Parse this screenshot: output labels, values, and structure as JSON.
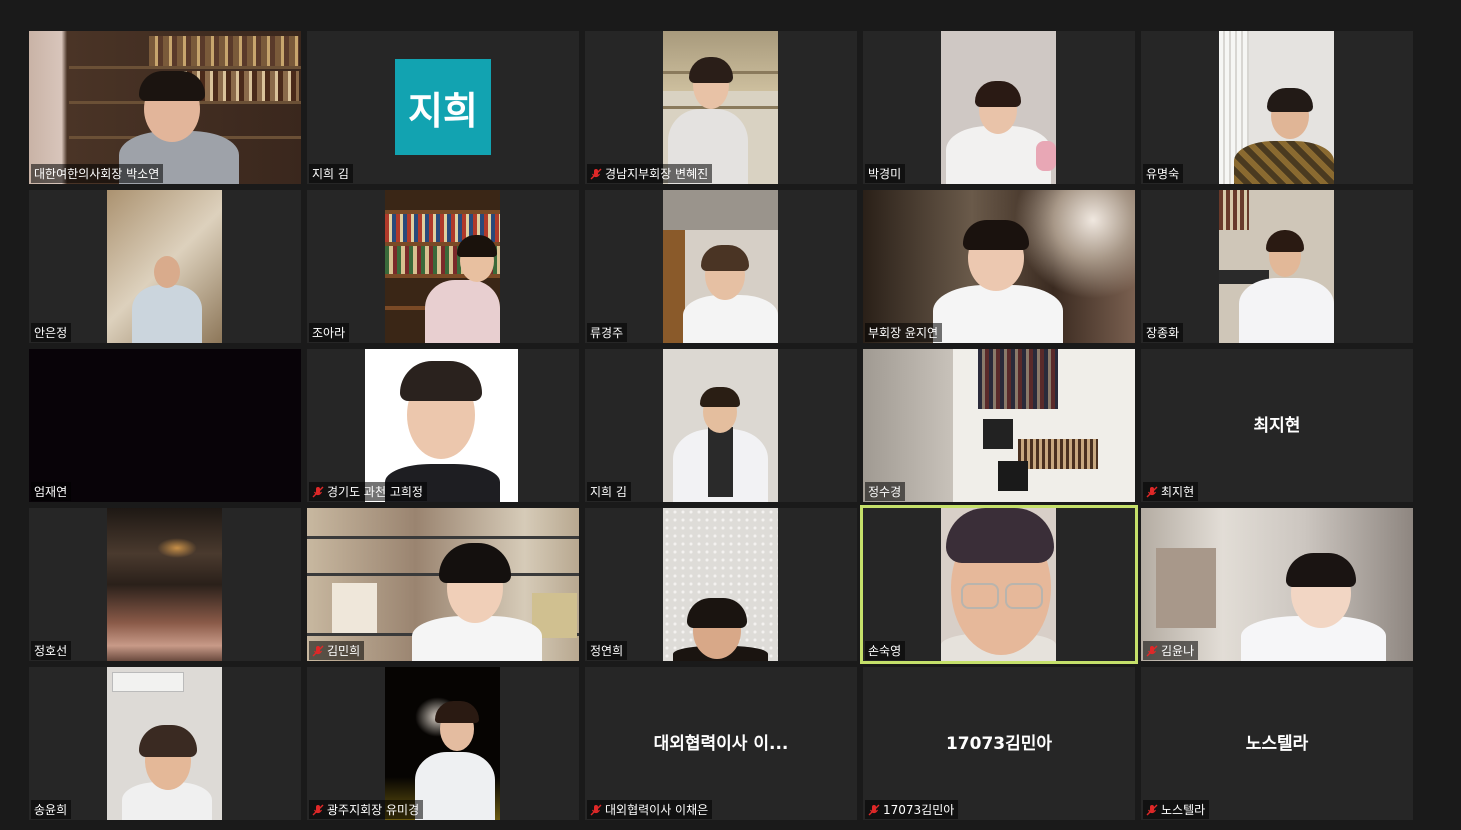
{
  "meeting": {
    "active_speaker": "손숙영",
    "accent_color": "#c5e06a",
    "avatar_color": "#12a3b1",
    "participants": [
      {
        "name": "대한여한의사회장 박소연",
        "muted": false,
        "type": "video"
      },
      {
        "name": "지희 김",
        "muted": false,
        "type": "avatar",
        "avatar_text": "지희"
      },
      {
        "name": "경남지부회장 변혜진",
        "muted": true,
        "type": "video"
      },
      {
        "name": "박경미",
        "muted": false,
        "type": "video"
      },
      {
        "name": "유명숙",
        "muted": false,
        "type": "video"
      },
      {
        "name": "안은정",
        "muted": false,
        "type": "video"
      },
      {
        "name": "조아라",
        "muted": false,
        "type": "video"
      },
      {
        "name": "류경주",
        "muted": false,
        "type": "video"
      },
      {
        "name": "부회장 윤지연",
        "muted": false,
        "type": "video"
      },
      {
        "name": "장종화",
        "muted": false,
        "type": "video"
      },
      {
        "name": "엄재연",
        "muted": false,
        "type": "video"
      },
      {
        "name": "경기도 과천 고희정",
        "muted": true,
        "type": "video"
      },
      {
        "name": "지희 김",
        "muted": false,
        "type": "video"
      },
      {
        "name": "정수경",
        "muted": false,
        "type": "video"
      },
      {
        "name": "최지현",
        "muted": true,
        "type": "name",
        "center_text": "최지현"
      },
      {
        "name": "정호선",
        "muted": false,
        "type": "video"
      },
      {
        "name": "김민희",
        "muted": true,
        "type": "video"
      },
      {
        "name": "정연희",
        "muted": false,
        "type": "video"
      },
      {
        "name": "손숙영",
        "muted": false,
        "type": "video"
      },
      {
        "name": "김윤나",
        "muted": true,
        "type": "video"
      },
      {
        "name": "송윤희",
        "muted": false,
        "type": "video"
      },
      {
        "name": "광주지회장 유미경",
        "muted": true,
        "type": "video"
      },
      {
        "name": "대외협력이사 이채은",
        "muted": true,
        "type": "name",
        "center_text": "대외협력이사 이..."
      },
      {
        "name": "17073김민아",
        "muted": true,
        "type": "name",
        "center_text": "17073김민아"
      },
      {
        "name": "노스텔라",
        "muted": true,
        "type": "name",
        "center_text": "노스텔라"
      }
    ]
  }
}
